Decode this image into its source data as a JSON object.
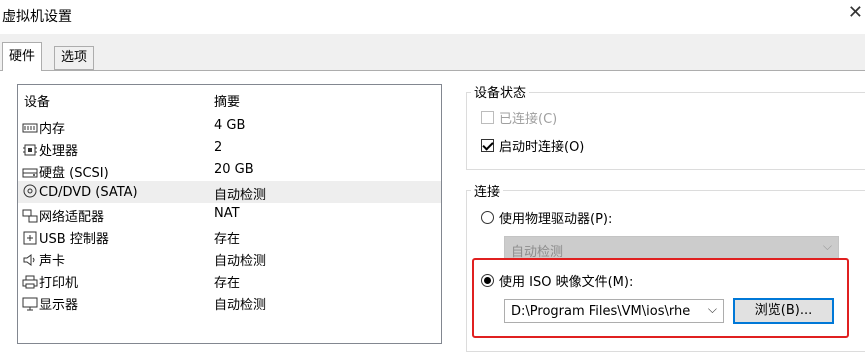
{
  "window": {
    "title": "虚拟机设置"
  },
  "tabs": [
    {
      "label": "硬件"
    },
    {
      "label": "选项"
    }
  ],
  "device_list": {
    "headers": {
      "device": "设备",
      "summary": "摘要"
    },
    "rows": [
      {
        "name": "内存",
        "summary": "4 GB",
        "icon": "memory-icon"
      },
      {
        "name": "处理器",
        "summary": "2",
        "icon": "processor-icon"
      },
      {
        "name": "硬盘 (SCSI)",
        "summary": "20 GB",
        "icon": "hard-disk-icon"
      },
      {
        "name": "CD/DVD (SATA)",
        "summary": "自动检测",
        "icon": "cd-dvd-icon",
        "selected": true
      },
      {
        "name": "网络适配器",
        "summary": "NAT",
        "icon": "network-adapter-icon"
      },
      {
        "name": "USB 控制器",
        "summary": "存在",
        "icon": "usb-icon"
      },
      {
        "name": "声卡",
        "summary": "自动检测",
        "icon": "sound-card-icon"
      },
      {
        "name": "打印机",
        "summary": "存在",
        "icon": "printer-icon"
      },
      {
        "name": "显示器",
        "summary": "自动检测",
        "icon": "display-icon"
      }
    ]
  },
  "device_status": {
    "label": "设备状态",
    "connected": {
      "label": "已连接(C)",
      "checked": false,
      "enabled": false
    },
    "connect_at_power_on": {
      "label": "启动时连接(O)",
      "checked": true,
      "enabled": true
    }
  },
  "connection": {
    "label": "连接",
    "physical_drive": {
      "label": "使用物理驱动器(P):",
      "selected": false,
      "value": "自动检测"
    },
    "iso_image": {
      "label": "使用 ISO 映像文件(M):",
      "selected": true,
      "value": "D:\\Program Files\\VM\\ios\\rhe",
      "browse_label": "浏览(B)..."
    }
  },
  "colors": {
    "highlight": "#e02020",
    "focus": "#0078d7"
  }
}
